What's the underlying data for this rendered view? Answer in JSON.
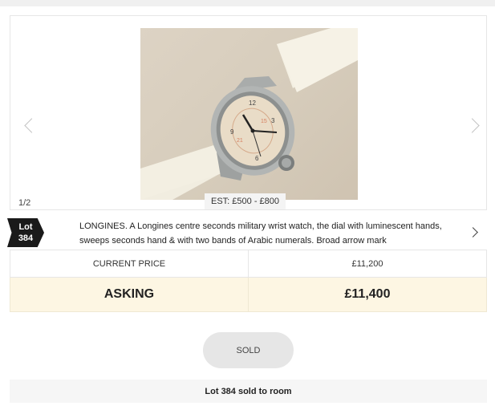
{
  "gallery": {
    "counter": "1/2",
    "estimate": "EST: £500 - £800"
  },
  "lot": {
    "label": "Lot",
    "number": "384",
    "description": "LONGINES. A Longines centre seconds military wrist watch, the dial with luminescent hands, sweeps seconds hand & with two bands of Arabic numerals. Broad arrow mark"
  },
  "pricing": {
    "current_label": "CURRENT PRICE",
    "current_value": "£11,200",
    "asking_label": "ASKING",
    "asking_value": "£11,400"
  },
  "sold_button": "SOLD",
  "status": "Lot 384 sold to room",
  "colors": {
    "asking_background": "#fdf6e3",
    "lot_badge": "#1a1a1a"
  }
}
